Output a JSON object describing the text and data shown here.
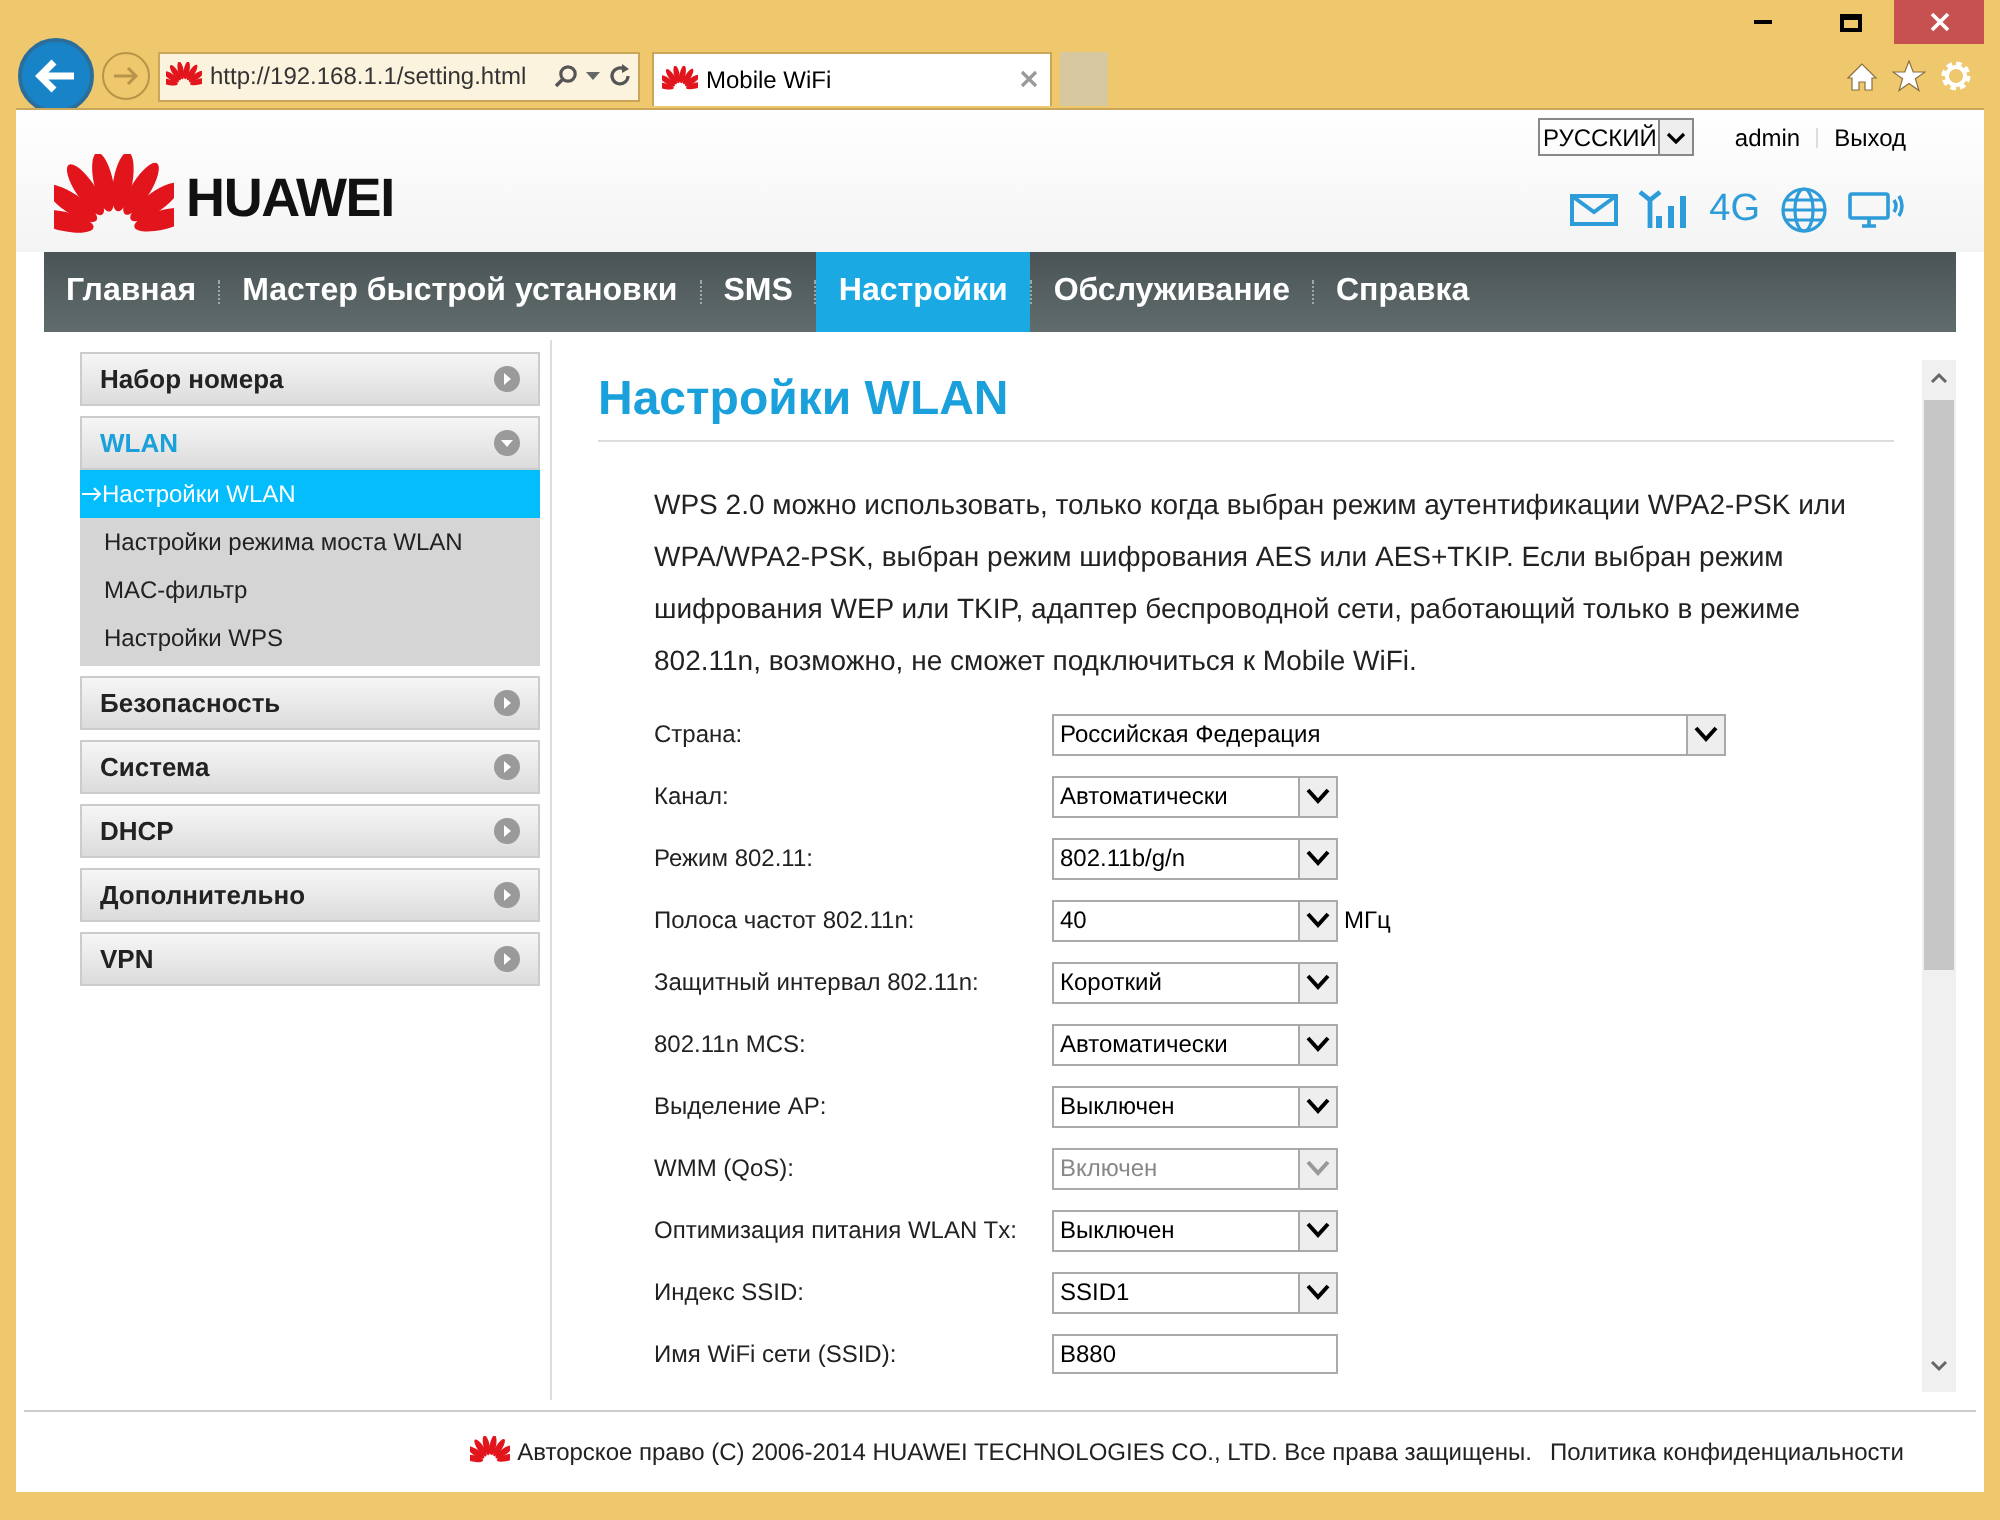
{
  "browser": {
    "address": "http://192.168.1.1/setting.html",
    "tab": {
      "title": "Mobile WiFi"
    }
  },
  "header": {
    "logo": "HUAWEI",
    "language": "РУССКИЙ",
    "user": "admin",
    "logout": "Выход",
    "network": "4G"
  },
  "nav": [
    {
      "label": "Главная",
      "selected": false
    },
    {
      "label": "Мастер быстрой установки",
      "selected": false
    },
    {
      "label": "SMS",
      "selected": false
    },
    {
      "label": "Настройки",
      "selected": true
    },
    {
      "label": "Обслуживание",
      "selected": false
    },
    {
      "label": "Справка",
      "selected": false
    }
  ],
  "sidebar": [
    {
      "label": "Набор номера",
      "expanded": false
    },
    {
      "label": "WLAN",
      "expanded": true,
      "children": [
        {
          "label": "Настройки WLAN",
          "selected": true
        },
        {
          "label": "Настройки режима моста WLAN",
          "selected": false
        },
        {
          "label": "MAC-фильтр",
          "selected": false
        },
        {
          "label": "Настройки WPS",
          "selected": false
        }
      ]
    },
    {
      "label": "Безопасность",
      "expanded": false
    },
    {
      "label": "Система",
      "expanded": false
    },
    {
      "label": "DHCP",
      "expanded": false
    },
    {
      "label": "Дополнительно",
      "expanded": false
    },
    {
      "label": "VPN",
      "expanded": false
    }
  ],
  "content": {
    "title": "Настройки WLAN",
    "note": "WPS 2.0 можно использовать, только когда выбран режим аутентификации WPA2-PSK или WPA/WPA2-PSK, выбран режим шифрования AES или AES+TKIP. Если выбран режим шифрования WEP или TKIP, адаптер беспроводной сети, работающий только в режиме 802.11n, возможно, не сможет подключиться к Mobile WiFi.",
    "fields": [
      {
        "label": "Страна:",
        "kind": "wide-select",
        "value": "Российская Федерация",
        "disabled": false
      },
      {
        "label": "Канал:",
        "kind": "select",
        "value": "Автоматически",
        "disabled": false
      },
      {
        "label": "Режим 802.11:",
        "kind": "select",
        "value": "802.11b/g/n",
        "disabled": false
      },
      {
        "label": "Полоса частот 802.11n:",
        "kind": "select",
        "value": "40",
        "disabled": false,
        "unit": "МГц"
      },
      {
        "label": "Защитный интервал 802.11n:",
        "kind": "select",
        "value": "Короткий",
        "disabled": false
      },
      {
        "label": "802.11n MCS:",
        "kind": "select",
        "value": "Автоматически",
        "disabled": false
      },
      {
        "label": "Выделение AP:",
        "kind": "select",
        "value": "Выключен",
        "disabled": false
      },
      {
        "label": "WMM (QoS):",
        "kind": "select",
        "value": "Включен",
        "disabled": true
      },
      {
        "label": "Оптимизация питания WLAN Tx:",
        "kind": "select",
        "value": "Выключен",
        "disabled": false
      },
      {
        "label": "Индекс SSID:",
        "kind": "select",
        "value": "SSID1",
        "disabled": false
      },
      {
        "label": "Имя WiFi сети (SSID):",
        "kind": "text",
        "value": "B880"
      }
    ]
  },
  "footer": {
    "copyright": "Авторское право (C) 2006-2014 HUAWEI TECHNOLOGIES CO., LTD. Все права защищены.",
    "privacy": "Политика конфиденциальности"
  }
}
